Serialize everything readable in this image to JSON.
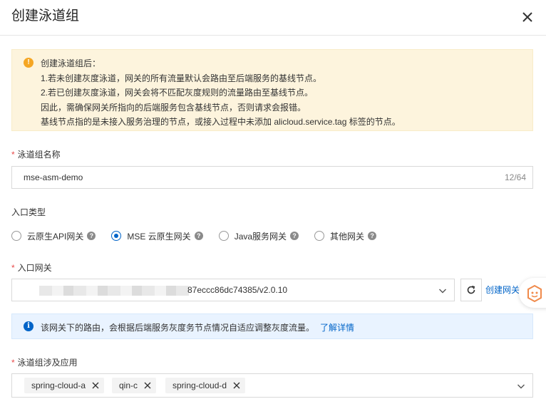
{
  "dialog": {
    "title": "创建泳道组"
  },
  "warning": {
    "lines": [
      "创建泳道组后：",
      "1.若未创建灰度泳道，网关的所有流量默认会路由至后端服务的基线节点。",
      "2.若已创建灰度泳道，网关会将不匹配灰度规则的流量路由至基线节点。",
      "因此，需确保网关所指向的后端服务包含基线节点，否则请求会报错。",
      "基线节点指的是未接入服务治理的节点，或接入过程中未添加 alicloud.service.tag 标签的节点。"
    ]
  },
  "form": {
    "required_mark": "*",
    "group_name": {
      "label": "泳道组名称",
      "value": "mse-asm-demo",
      "counter": "12/64"
    },
    "entry_type": {
      "label": "入口类型",
      "selected": "MSE 云原生网关",
      "options": [
        "云原生API网关",
        "MSE 云原生网关",
        "Java服务网关",
        "其他网关"
      ]
    },
    "gateway": {
      "label": "入口网关",
      "value_visible": "87eccc86dc74385/v2.0.10",
      "refresh_icon": "refresh-icon",
      "create_link": "创建网关"
    },
    "info": {
      "text": "该网关下的路由，会根据后端服务灰度务节点情况自适应调整灰度流量。",
      "link": "了解详情"
    },
    "apps": {
      "label": "泳道组涉及应用",
      "tags": [
        "spring-cloud-a",
        "qin-c",
        "spring-cloud-d"
      ]
    }
  },
  "colors": {
    "primary": "#0064c8",
    "warning_bg": "#fdf4dd",
    "info_bg": "#e9f3ff",
    "required": "#e84a4a"
  }
}
